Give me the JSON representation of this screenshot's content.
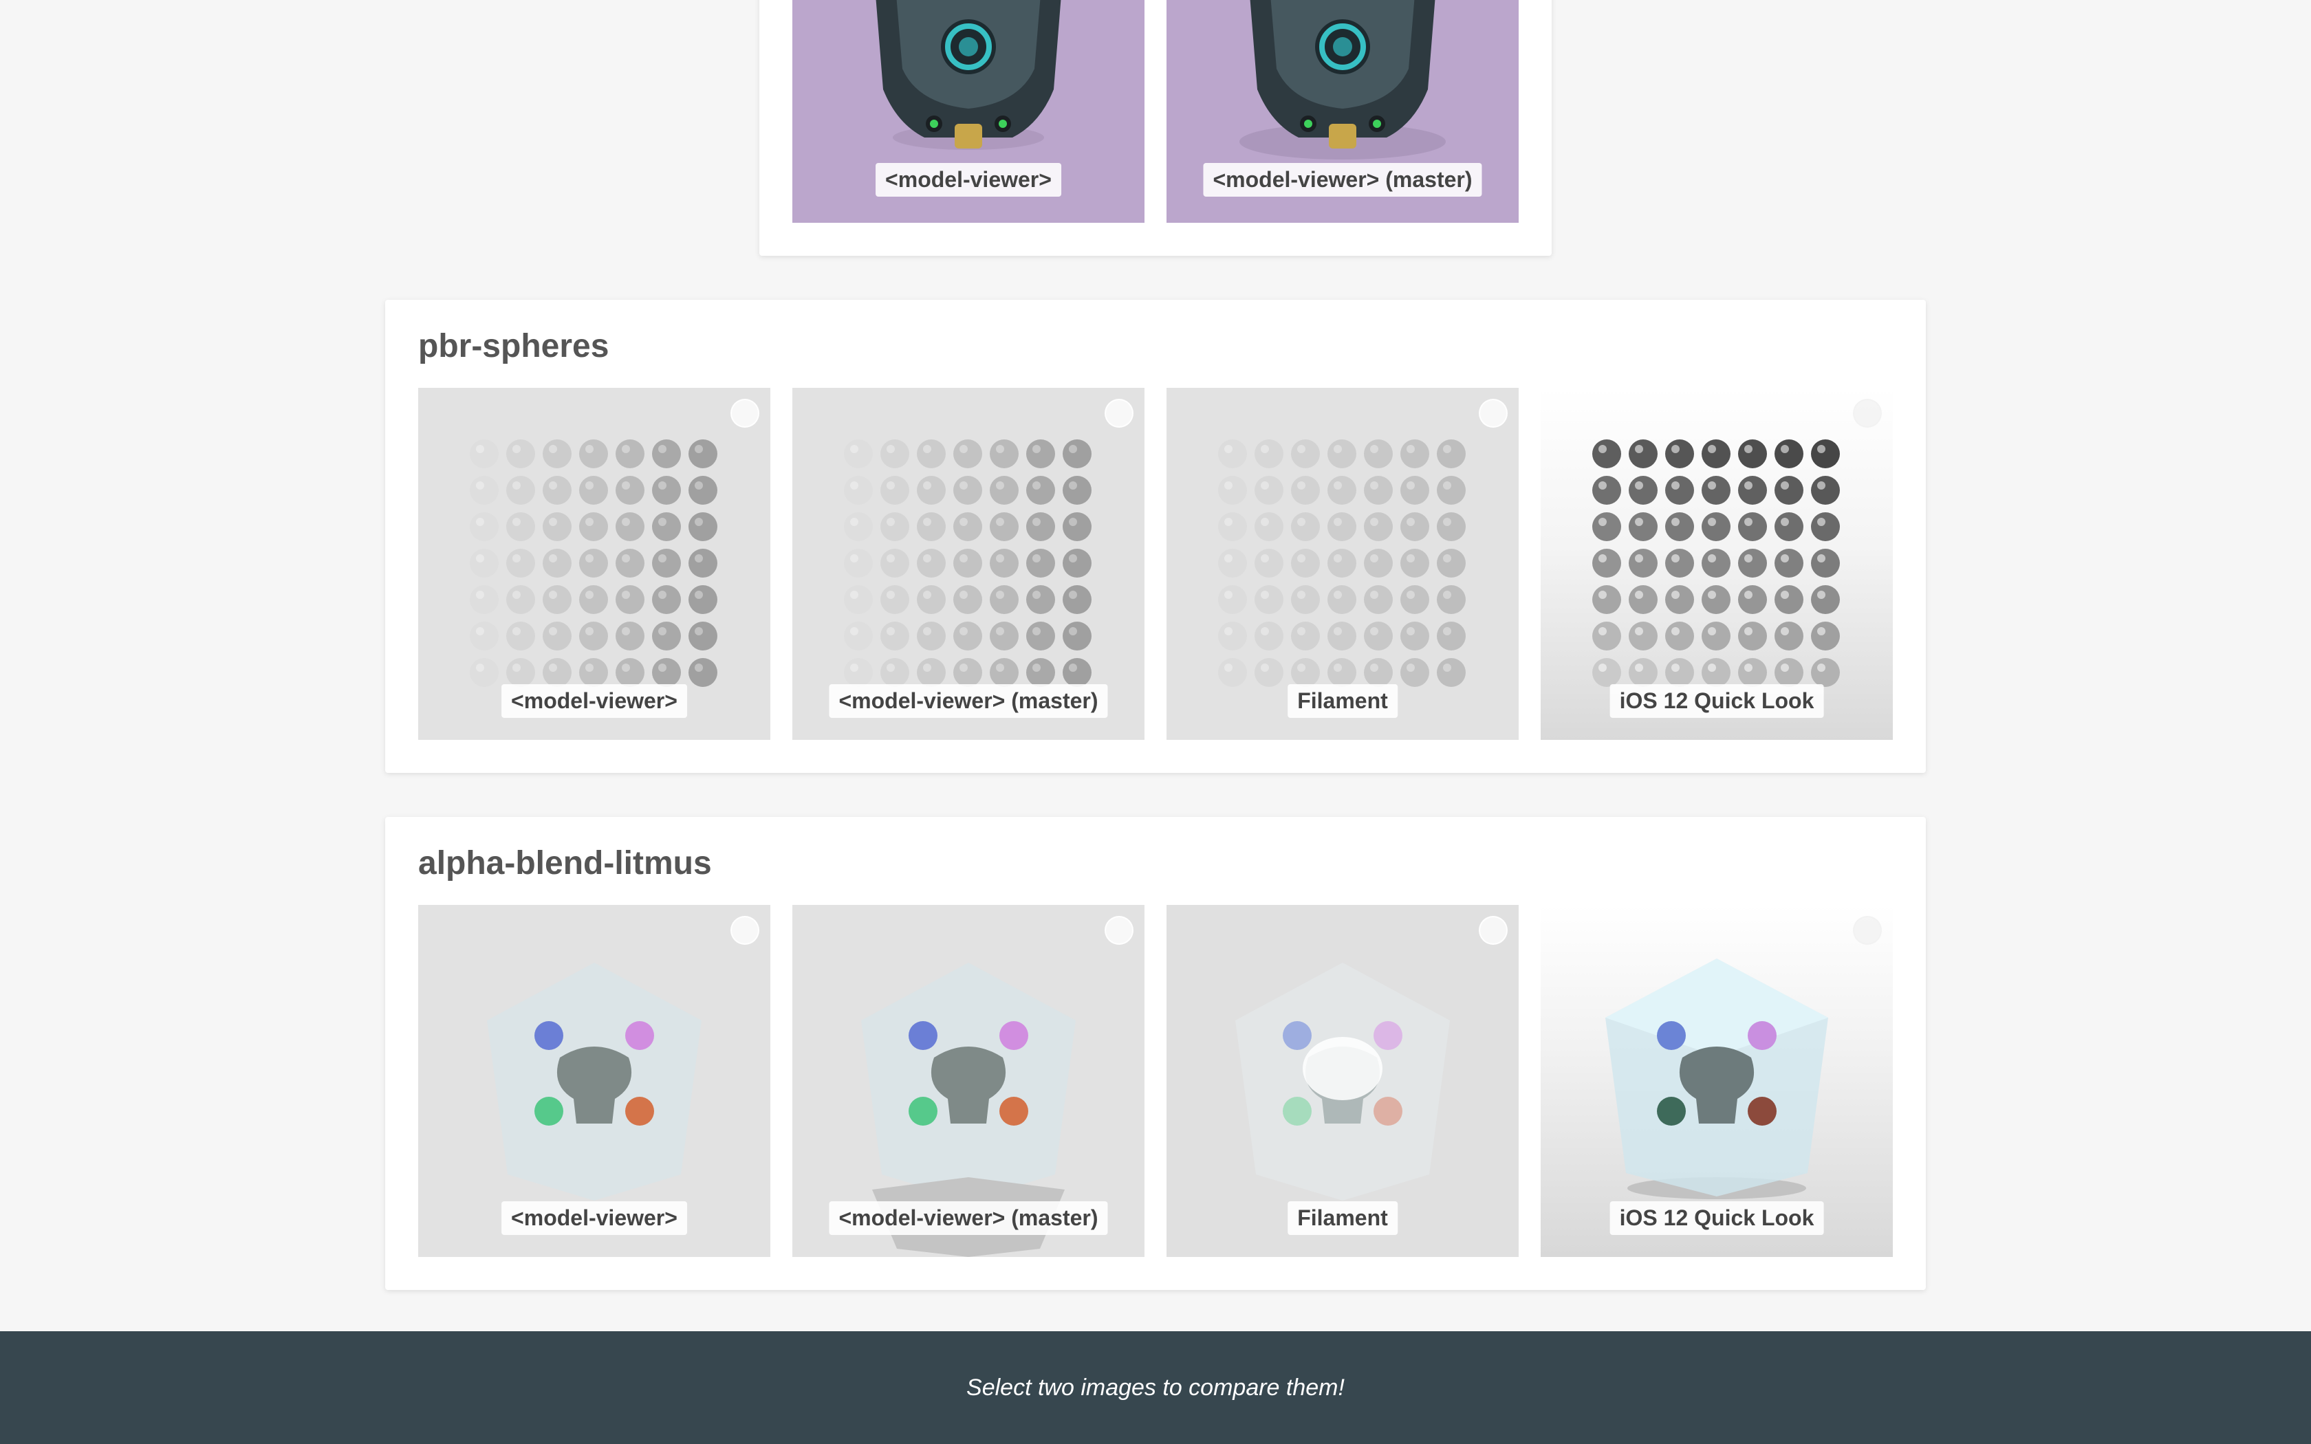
{
  "sections": [
    {
      "id": "helmet",
      "title": "",
      "tiles": [
        {
          "label": "<model-viewer>"
        },
        {
          "label": "<model-viewer> (master)"
        }
      ]
    },
    {
      "id": "pbr-spheres",
      "title": "pbr-spheres",
      "tiles": [
        {
          "label": "<model-viewer>"
        },
        {
          "label": "<model-viewer> (master)"
        },
        {
          "label": "Filament"
        },
        {
          "label": "iOS 12 Quick Look"
        }
      ]
    },
    {
      "id": "alpha-blend-litmus",
      "title": "alpha-blend-litmus",
      "tiles": [
        {
          "label": "<model-viewer>"
        },
        {
          "label": "<model-viewer> (master)"
        },
        {
          "label": "Filament"
        },
        {
          "label": "iOS 12 Quick Look"
        }
      ]
    }
  ],
  "footer": {
    "message": "Select two images to compare them!"
  },
  "colors": {
    "page_bg": "#f6f6f6",
    "footer_bg": "#37474f",
    "helmet_bg": "#bba6cc",
    "tile_bg": "#e3e3e3"
  }
}
